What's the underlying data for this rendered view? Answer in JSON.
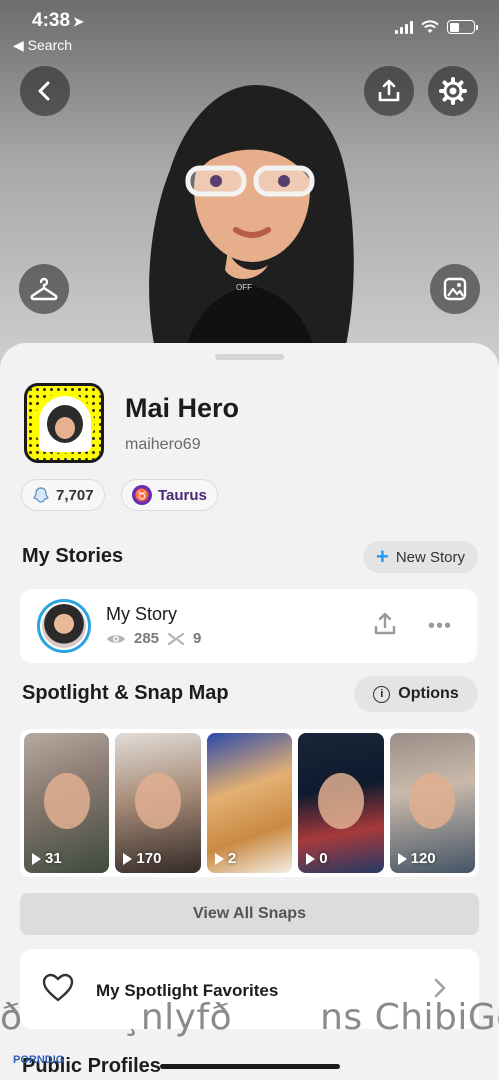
{
  "status_bar": {
    "time": "4:38",
    "back_label": "◀ Search"
  },
  "colors": {
    "accent_blue": "#1f9cff",
    "snap_yellow": "#fffc00",
    "zodiac_purple": "#6a2bb5",
    "story_ring": "#2aa4e0"
  },
  "hero": {
    "icons": [
      "back-icon",
      "share-icon",
      "settings-icon",
      "hanger-icon",
      "photo-icon"
    ]
  },
  "profile": {
    "display_name": "Mai Hero",
    "username": "maihero69",
    "snap_score": "7,707",
    "zodiac": "Taurus"
  },
  "my_stories": {
    "title": "My Stories",
    "new_story_label": "New Story",
    "story": {
      "title": "My Story",
      "views": "285",
      "screenshots": "9"
    }
  },
  "spotlight": {
    "title": "Spotlight & Snap Map",
    "options_label": "Options",
    "snaps": [
      {
        "count": "31"
      },
      {
        "count": "170"
      },
      {
        "count": "2"
      },
      {
        "count": "0"
      },
      {
        "count": "120"
      }
    ],
    "view_all_label": "View All Snaps"
  },
  "favorites": {
    "label": "My Spotlight Favorites"
  },
  "public_profiles": {
    "title": "Public Profiles"
  },
  "watermark": {
    "text": "ð ¸nlyfðns ChibiGodde",
    "brand": "PORNDIG"
  }
}
